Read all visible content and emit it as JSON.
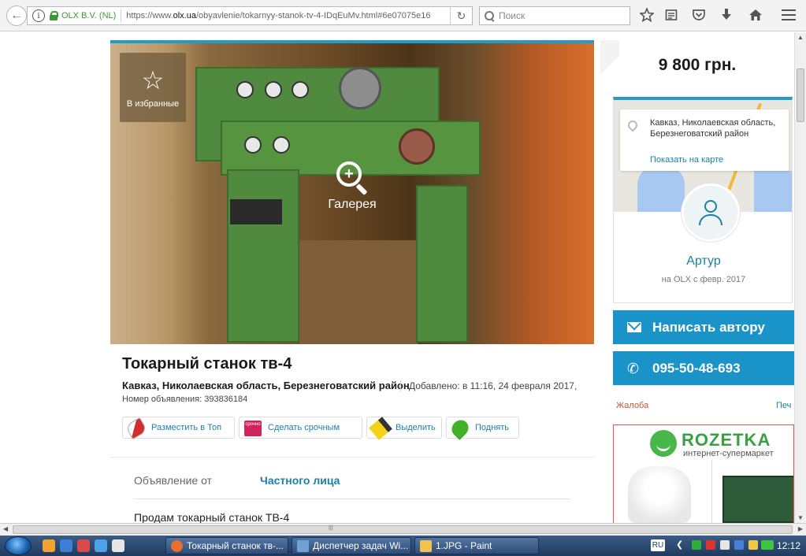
{
  "browser": {
    "site_identity": "OLX B.V. (NL)",
    "url_prefix": "https://www.",
    "url_domain": "olx.ua",
    "url_path": "/obyavlenie/tokarnyy-stanok-tv-4-IDqEuMv.html#6e07075e16",
    "search_placeholder": "Поиск",
    "info_glyph": "i",
    "reload_glyph": "↻"
  },
  "gallery": {
    "favorite_label": "В избранные",
    "favorite_glyph": "☆",
    "gallery_label": "Галерея",
    "zoom_glyph": "+"
  },
  "ad": {
    "title": "Токарный станок тв-4",
    "location": "Кавказ, Николаевская область, Березнеговатский район",
    "added": "Добавлено: в 11:16, 24 февраля 2017,",
    "number": "Номер объявления: 393836184",
    "promo": [
      {
        "label": "Разместить в Топ",
        "icon": "rocket-icon"
      },
      {
        "label": "Сделать срочным",
        "icon": "urgent-label-icon",
        "icon_text": "срочно"
      },
      {
        "label": "Выделить",
        "icon": "marker-icon"
      },
      {
        "label": "Поднять",
        "icon": "up-arrow-icon"
      }
    ],
    "from_label": "Объявление от",
    "from_value": "Частного лица",
    "description": "Продам токарный станок ТВ-4"
  },
  "sidebar": {
    "price": "9 800 грн.",
    "location_text": "Кавказ, Николаевская область, Березнеговатский район",
    "show_map": "Показать на карте",
    "user_name": "Артур",
    "user_since": "на OLX с февр. 2017",
    "message_button": "Написать автору",
    "phone_button": "095-50-48-693",
    "phone_glyph": "✆",
    "report": "Жалоба",
    "print": "Печ"
  },
  "banner": {
    "brand": "ROZETKA",
    "tagline": "интернет-супермаркет"
  },
  "taskbar": {
    "tasks": [
      {
        "label": "Токарный станок тв-...",
        "icon_color": "#e8702a"
      },
      {
        "label": "Диспетчер задач Wi...",
        "icon_color": "#6fa3d6"
      },
      {
        "label": "1.JPG - Paint",
        "icon_color": "#f2c14e"
      }
    ],
    "lang": "RU",
    "tray_arrow": "❮",
    "clock": "12:12"
  },
  "scrollbar": {
    "up": "▲",
    "down": "▼",
    "left": "◀",
    "right": "▶",
    "grip": "|||"
  }
}
